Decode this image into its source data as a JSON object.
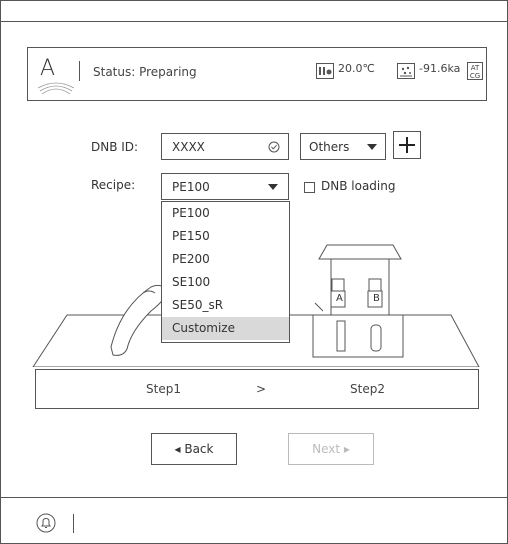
{
  "header": {
    "status_label": "Status: Preparing",
    "temperature": "20.0℃",
    "pressure": "-91.6ka",
    "atcg_badge": "AT CG",
    "logo_letter": "A"
  },
  "form": {
    "dnb_label": "DNB ID:",
    "dnb_value": "XXXX",
    "others_value": "Others",
    "recipe_label": "Recipe:",
    "recipe_value": "PE100",
    "dnb_loading_label": "DNB loading"
  },
  "recipe_options": [
    "PE100",
    "PE150",
    "PE200",
    "SE100",
    "SE50_sR",
    "Customize"
  ],
  "illustration": {
    "well_a": "A",
    "well_b": "B"
  },
  "steps": {
    "step1": "Step1",
    "arrow": ">",
    "step2": "Step2"
  },
  "nav": {
    "back": "◂ Back",
    "next": "Next ▸"
  },
  "colors": {
    "border": "#555555",
    "disabled": "#bbbbbb",
    "highlight": "#d9d9d9"
  }
}
